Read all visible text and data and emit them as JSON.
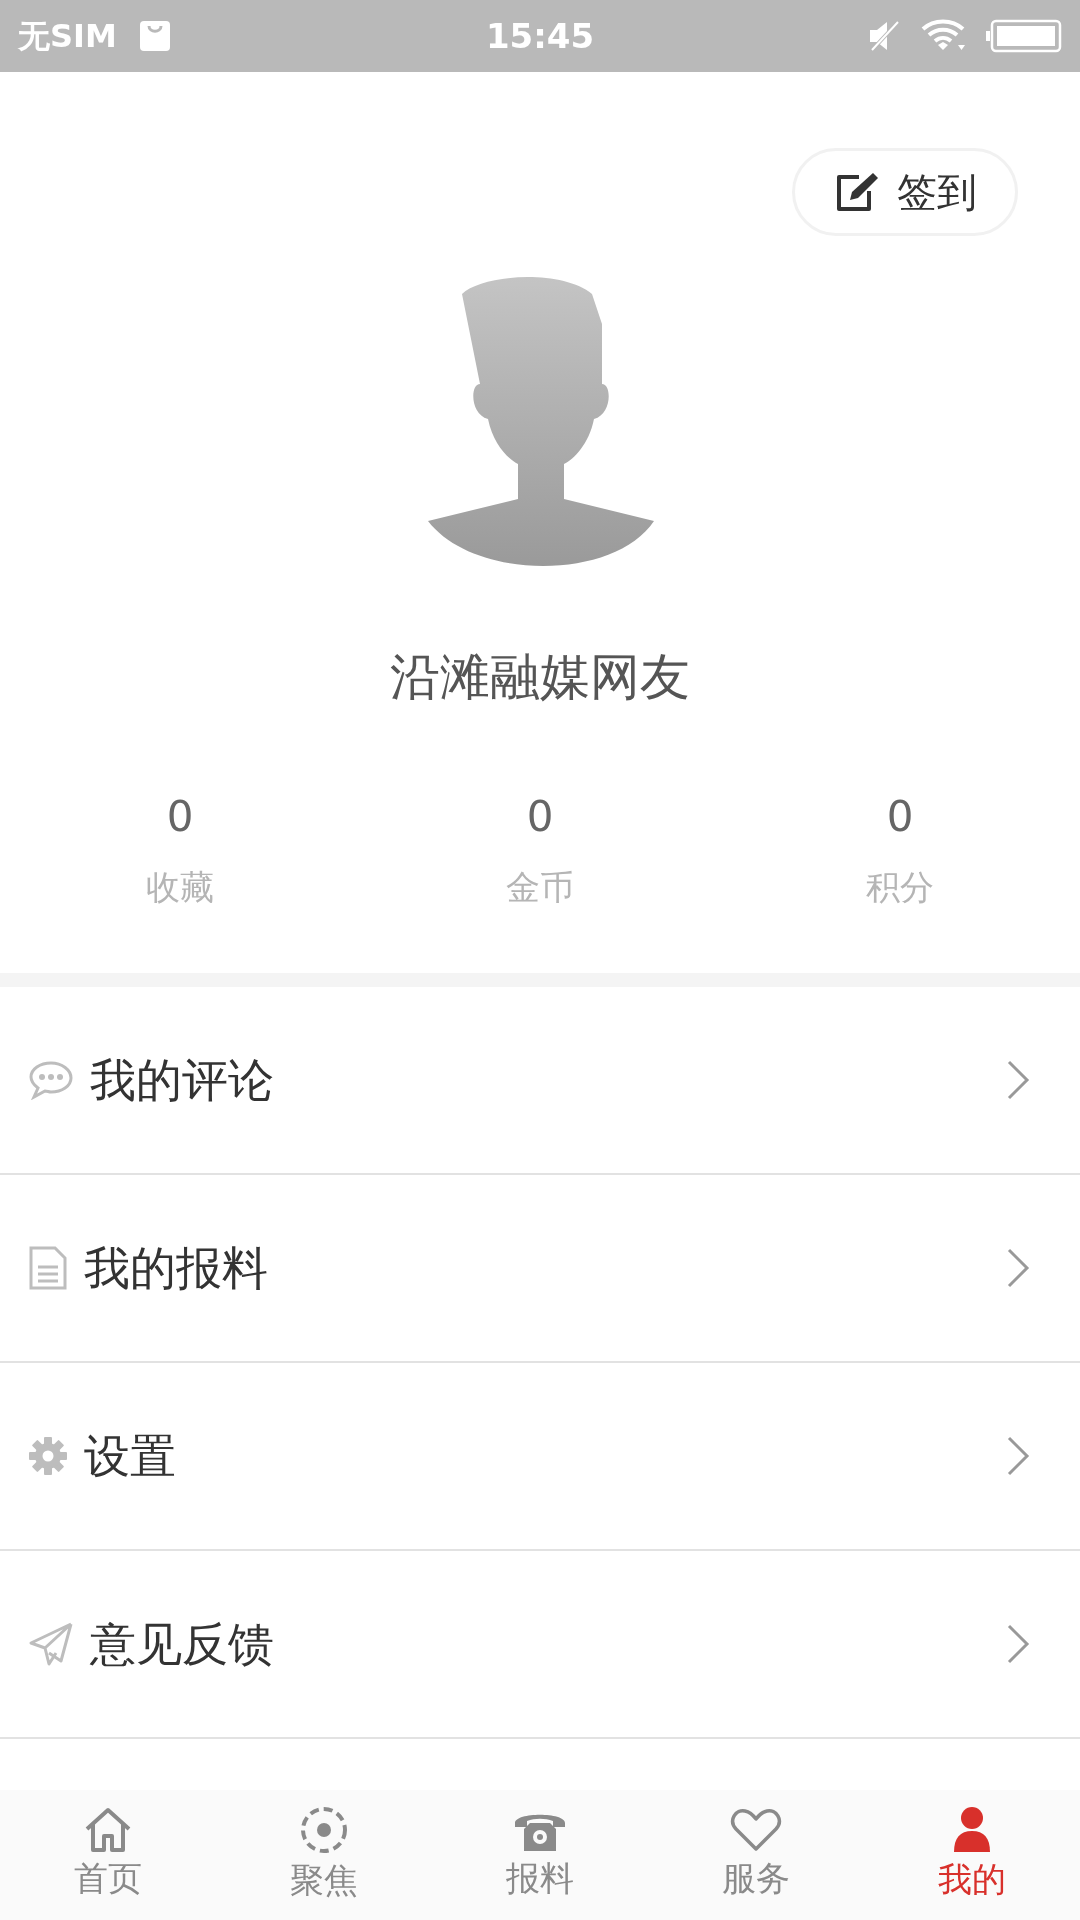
{
  "status_bar": {
    "carrier": "无SIM",
    "time": "15:45"
  },
  "sign_in_button": {
    "label": "签到"
  },
  "profile": {
    "name": "沿滩融媒网友"
  },
  "stats": [
    {
      "value": "0",
      "label": "收藏"
    },
    {
      "value": "0",
      "label": "金币"
    },
    {
      "value": "0",
      "label": "积分"
    }
  ],
  "menu": [
    {
      "kind": "comment",
      "label": "我的评论"
    },
    {
      "kind": "document",
      "label": "我的报料"
    },
    {
      "kind": "settings",
      "label": "设置"
    },
    {
      "kind": "feedback",
      "label": "意见反馈"
    }
  ],
  "tab_bar": [
    {
      "kind": "home",
      "label": "首页",
      "selected": false
    },
    {
      "kind": "focus",
      "label": "聚焦",
      "selected": false
    },
    {
      "kind": "phone",
      "label": "报料",
      "selected": false
    },
    {
      "kind": "service",
      "label": "服务",
      "selected": false
    },
    {
      "kind": "me",
      "label": "我的",
      "selected": true
    }
  ]
}
